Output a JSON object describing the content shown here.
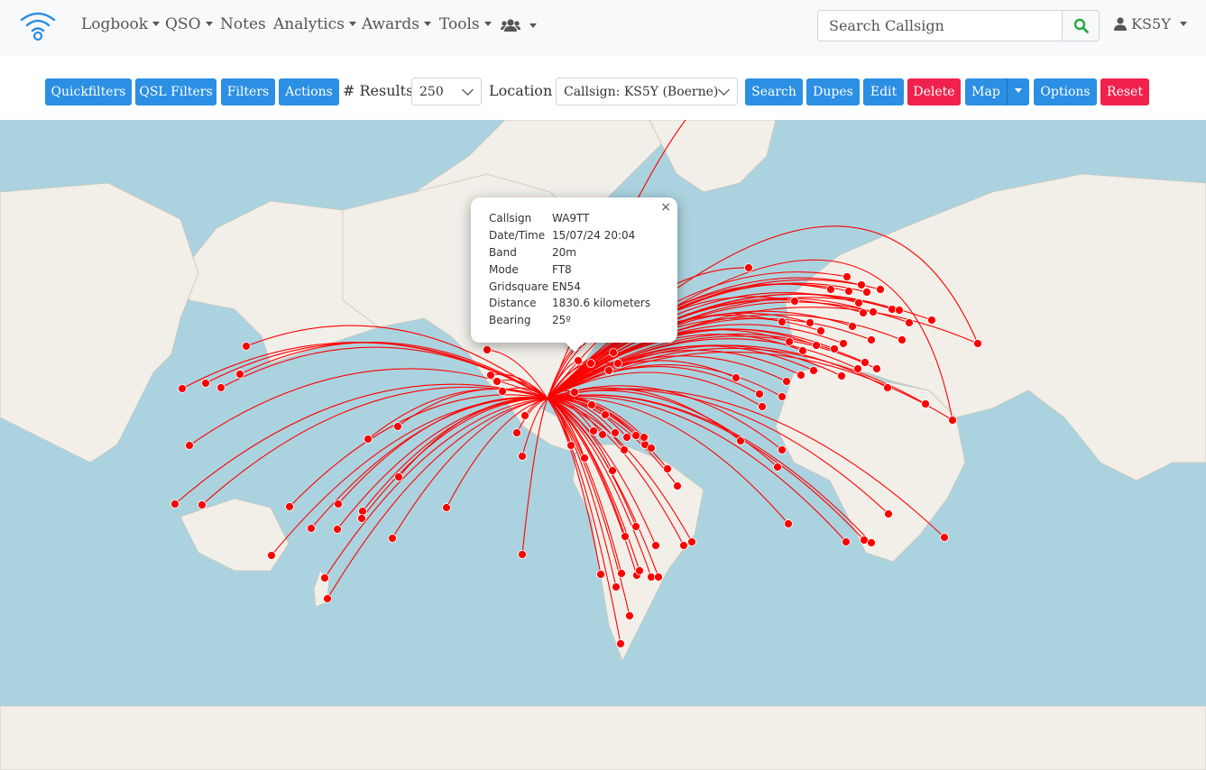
{
  "navbar": {
    "brand_icon": "wifi-signal-icon",
    "items": [
      {
        "label": "Logbook",
        "dropdown": true
      },
      {
        "label": "QSO",
        "dropdown": true
      },
      {
        "label": "Notes",
        "dropdown": false
      },
      {
        "label": "Analytics",
        "dropdown": true
      },
      {
        "label": "Awards",
        "dropdown": true
      },
      {
        "label": "Tools",
        "dropdown": true
      }
    ],
    "users_icon": "users-icon",
    "search_placeholder": "Search Callsign",
    "search_icon": "search-icon",
    "user_label": "KS5Y",
    "user_icon": "user-icon"
  },
  "toolbar": {
    "quickfilters": "Quickfilters",
    "qsl_filters": "QSL Filters",
    "filters": "Filters",
    "actions": "Actions",
    "results_label": "# Results",
    "results_value": "250",
    "location_label": "Location",
    "location_value": "Callsign: KS5Y (Boerne)",
    "search": "Search",
    "dupes": "Dupes",
    "edit": "Edit",
    "delete": "Delete",
    "map": "Map",
    "options": "Options",
    "reset": "Reset"
  },
  "colors": {
    "primary": "#2b8fe3",
    "danger": "#f0224d",
    "path": "#ff0000",
    "water": "#aad3df",
    "land": "#f2efe9",
    "search_icon": "#28a745"
  },
  "popup": {
    "rows": [
      {
        "key": "Callsign",
        "value": "WA9TT"
      },
      {
        "key": "Date/Time",
        "value": "15/07/24 20:04"
      },
      {
        "key": "Band",
        "value": "20m"
      },
      {
        "key": "Mode",
        "value": "FT8"
      },
      {
        "key": "Gridsquare",
        "value": "EN54"
      },
      {
        "key": "Distance",
        "value": "1830.6 kilometers"
      },
      {
        "key": "Bearing",
        "value": "25º"
      }
    ],
    "close": "×"
  }
}
